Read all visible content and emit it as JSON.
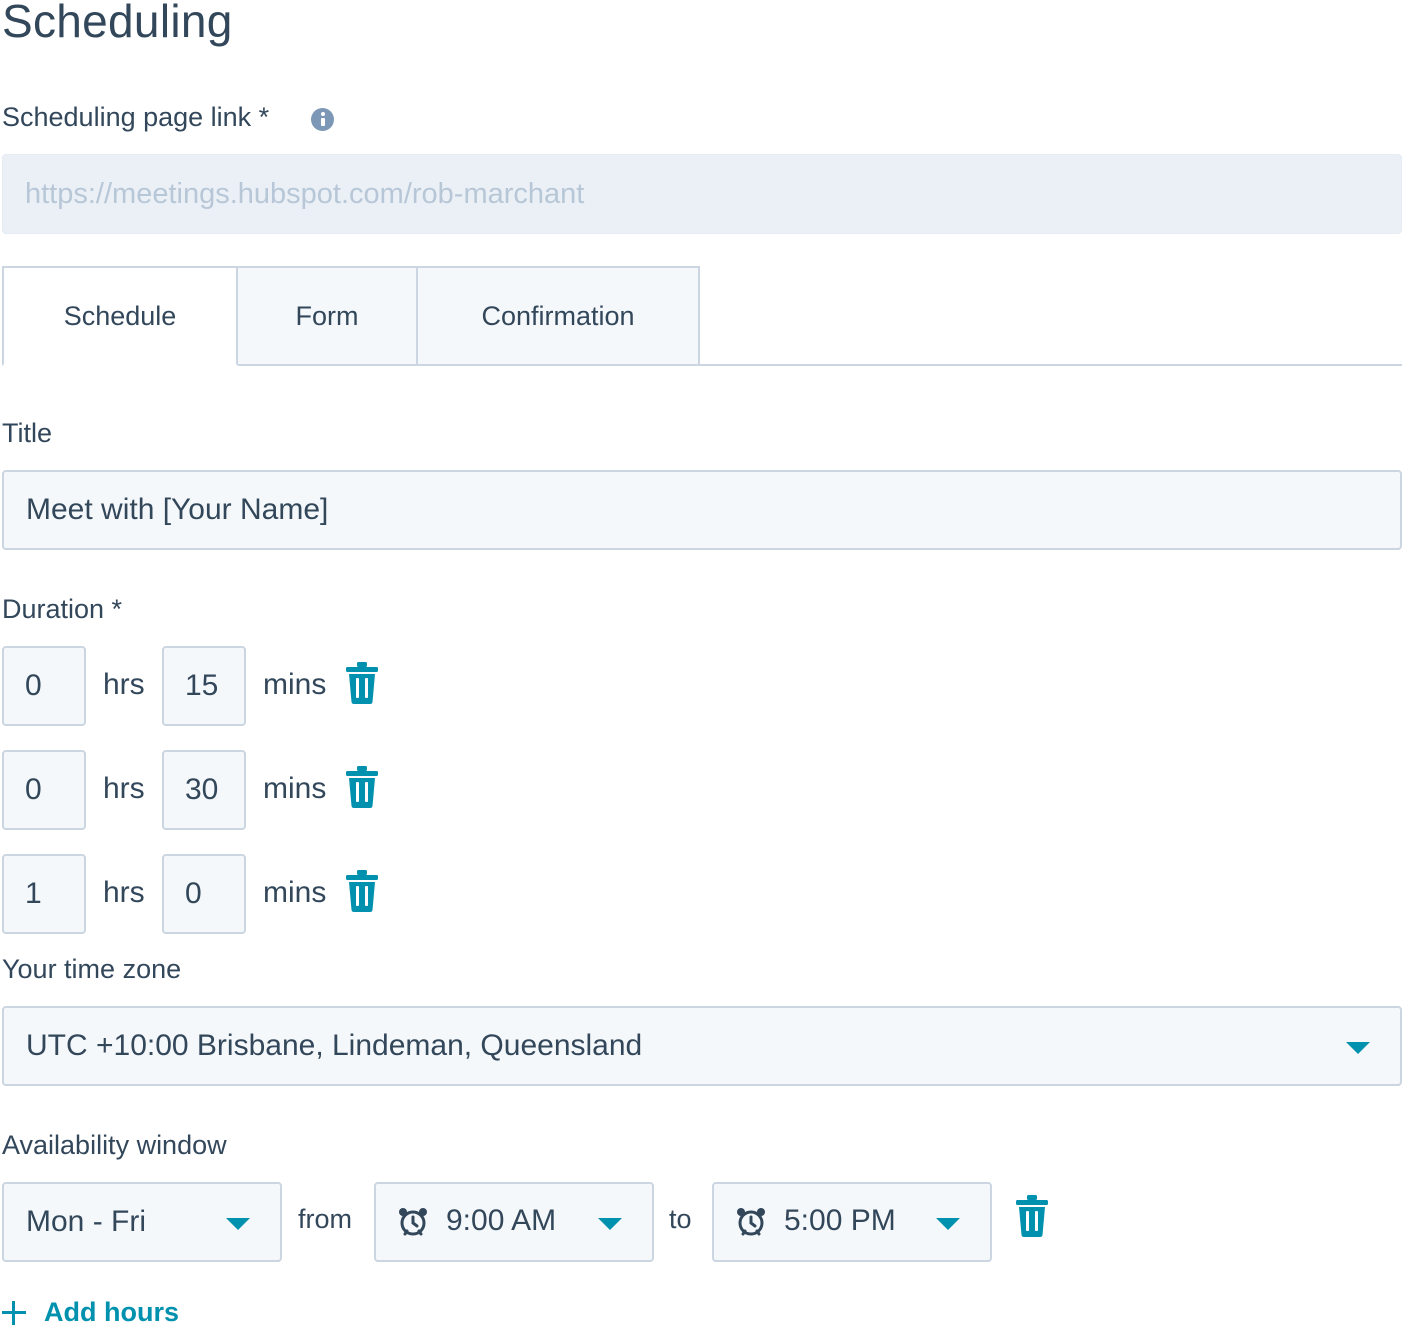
{
  "page": {
    "title": "Scheduling"
  },
  "link": {
    "label": "Scheduling page link *",
    "placeholder": "https://meetings.hubspot.com/rob-marchant"
  },
  "tabs": [
    {
      "label": "Schedule",
      "active": true
    },
    {
      "label": "Form",
      "active": false
    },
    {
      "label": "Confirmation",
      "active": false
    }
  ],
  "title_field": {
    "label": "Title",
    "value": "Meet with [Your Name]"
  },
  "duration": {
    "label": "Duration *",
    "hrs_unit": "hrs",
    "mins_unit": "mins",
    "rows": [
      {
        "hrs": "0",
        "mins": "15"
      },
      {
        "hrs": "0",
        "mins": "30"
      },
      {
        "hrs": "1",
        "mins": "0"
      }
    ]
  },
  "timezone": {
    "label": "Your time zone",
    "value": "UTC +10:00 Brisbane, Lindeman, Queensland"
  },
  "availability": {
    "label": "Availability window",
    "days": "Mon - Fri",
    "from_label": "from",
    "from_time": "9:00 AM",
    "to_label": "to",
    "to_time": "5:00 PM"
  },
  "add_hours_label": "Add hours",
  "colors": {
    "accent": "#0091ae",
    "text": "#33475b",
    "border": "#cbd6e2",
    "field_bg": "#f5f8fa",
    "disabled_bg": "#eaf0f6"
  },
  "icons": {
    "info": "info-icon",
    "delete": "trash-icon",
    "time": "alarm-clock-icon",
    "dropdown": "caret-down-icon",
    "add": "plus-icon"
  }
}
